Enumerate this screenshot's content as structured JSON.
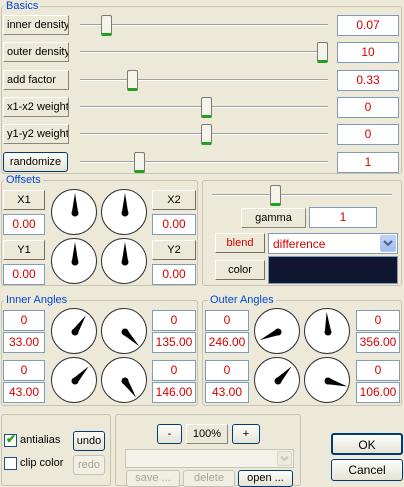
{
  "basics": {
    "title": "Basics",
    "rows": [
      {
        "label": "inner density",
        "value": "0.07",
        "slider": 0.07
      },
      {
        "label": "outer density",
        "value": "10",
        "slider": 1.0
      },
      {
        "label": "add factor",
        "value": "0.33",
        "slider": 0.18
      },
      {
        "label": "x1-x2 weight",
        "value": "0",
        "slider": 0.5
      },
      {
        "label": "y1-y2 weight",
        "value": "0",
        "slider": 0.5
      },
      {
        "label": "randomize",
        "value": "1",
        "slider": 0.21
      }
    ]
  },
  "offsets": {
    "title": "Offsets",
    "x1_label": "X1",
    "x1_value": "0.00",
    "x2_label": "X2",
    "x2_value": "0.00",
    "y1_label": "Y1",
    "y1_value": "0.00",
    "y2_label": "Y2",
    "y2_value": "0.00"
  },
  "blend_panel": {
    "gamma_label": "gamma",
    "gamma_value": "1",
    "gamma_slider": 0.34,
    "blend_label": "blend",
    "blend_value": "difference",
    "color_label": "color",
    "color_swatch": "#101630"
  },
  "inner_angles": {
    "title": "Inner Angles",
    "top_left_count": "0",
    "top_left_angle": "33.00",
    "top_right_count": "0",
    "top_right_angle": "135.00",
    "bottom_left_count": "0",
    "bottom_left_angle": "43.00",
    "bottom_right_count": "0",
    "bottom_right_angle": "146.00"
  },
  "outer_angles": {
    "title": "Outer Angles",
    "top_left_count": "0",
    "top_left_angle": "246.00",
    "top_right_count": "0",
    "top_right_angle": "356.00",
    "bottom_left_count": "0",
    "bottom_left_angle": "43.00",
    "bottom_right_count": "0",
    "bottom_right_angle": "106.00"
  },
  "bottom": {
    "antialias_label": "antialias",
    "antialias_checked": true,
    "clip_color_label": "clip color",
    "clip_color_checked": false,
    "undo_label": "undo",
    "redo_label": "redo",
    "zoom_minus": "-",
    "zoom_value": "100%",
    "zoom_plus": "+",
    "save_label": "save ...",
    "delete_label": "delete",
    "open_label": "open ...",
    "ok_label": "OK",
    "cancel_label": "Cancel"
  },
  "colors": {
    "accent": "#0046d5",
    "value_red": "#d40000",
    "slider_green": "#21a121",
    "background": "#ece9d8"
  }
}
